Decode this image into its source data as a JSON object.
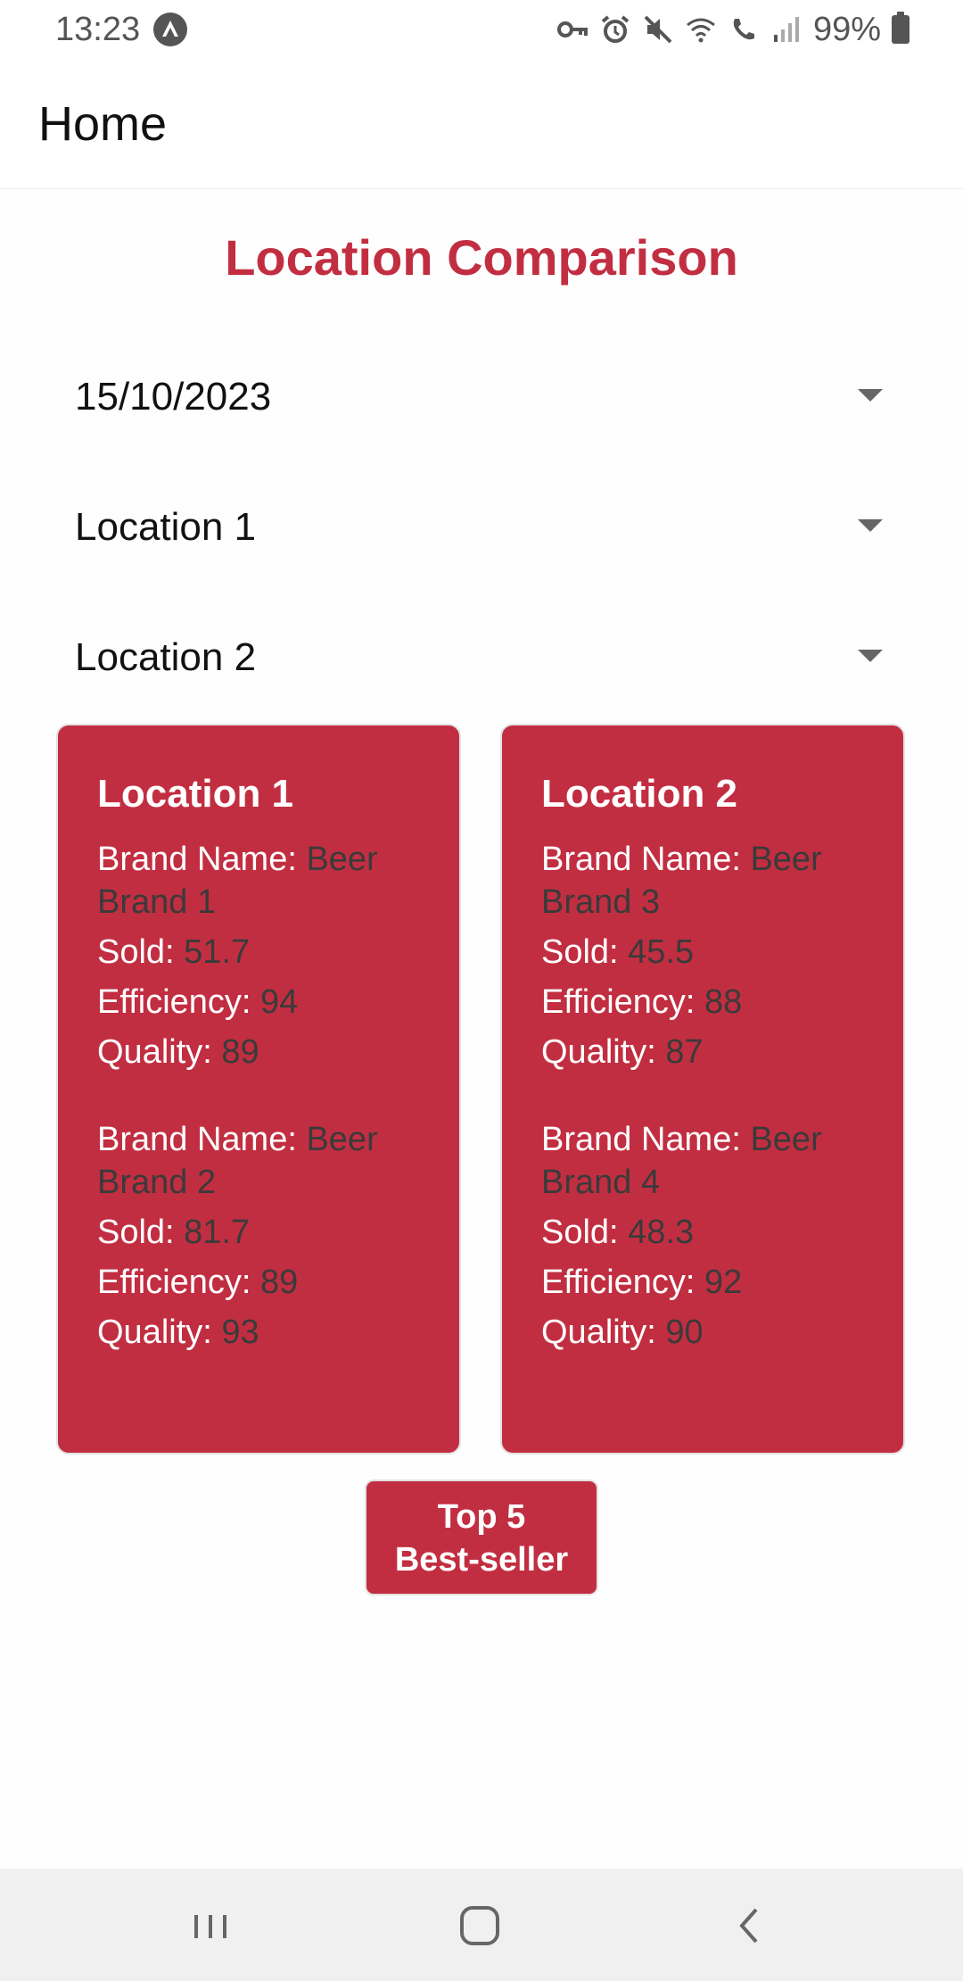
{
  "status_bar": {
    "time": "13:23",
    "battery": "99%",
    "icons": [
      "app-notification-icon",
      "vpn-key-icon",
      "alarm-icon",
      "mute-icon",
      "wifi-icon",
      "wifi-calling-icon",
      "signal-icon",
      "battery-icon"
    ]
  },
  "app_bar": {
    "title": "Home"
  },
  "main": {
    "title": "Location Comparison",
    "date_select": {
      "value": "15/10/2023"
    },
    "location1_select": {
      "value": "Location 1"
    },
    "location2_select": {
      "value": "Location 2"
    },
    "labels": {
      "brand_name": "Brand Name: ",
      "sold": "Sold: ",
      "efficiency": "Efficiency: ",
      "quality": "Quality: "
    },
    "cards": [
      {
        "title": "Location 1",
        "brands": [
          {
            "brand_name": "Beer Brand 1",
            "sold": "51.7",
            "efficiency": "94",
            "quality": "89"
          },
          {
            "brand_name": "Beer Brand 2",
            "sold": "81.7",
            "efficiency": "89",
            "quality": "93"
          }
        ]
      },
      {
        "title": "Location 2",
        "brands": [
          {
            "brand_name": "Beer Brand 3",
            "sold": "45.5",
            "efficiency": "88",
            "quality": "87"
          },
          {
            "brand_name": "Beer Brand 4",
            "sold": "48.3",
            "efficiency": "92",
            "quality": "90"
          }
        ]
      }
    ],
    "top_button_label_line1": "Top 5",
    "top_button_label_line2": "Best-seller"
  },
  "colors": {
    "accent": "#c22e41",
    "value_text": "#3a3a3a"
  }
}
